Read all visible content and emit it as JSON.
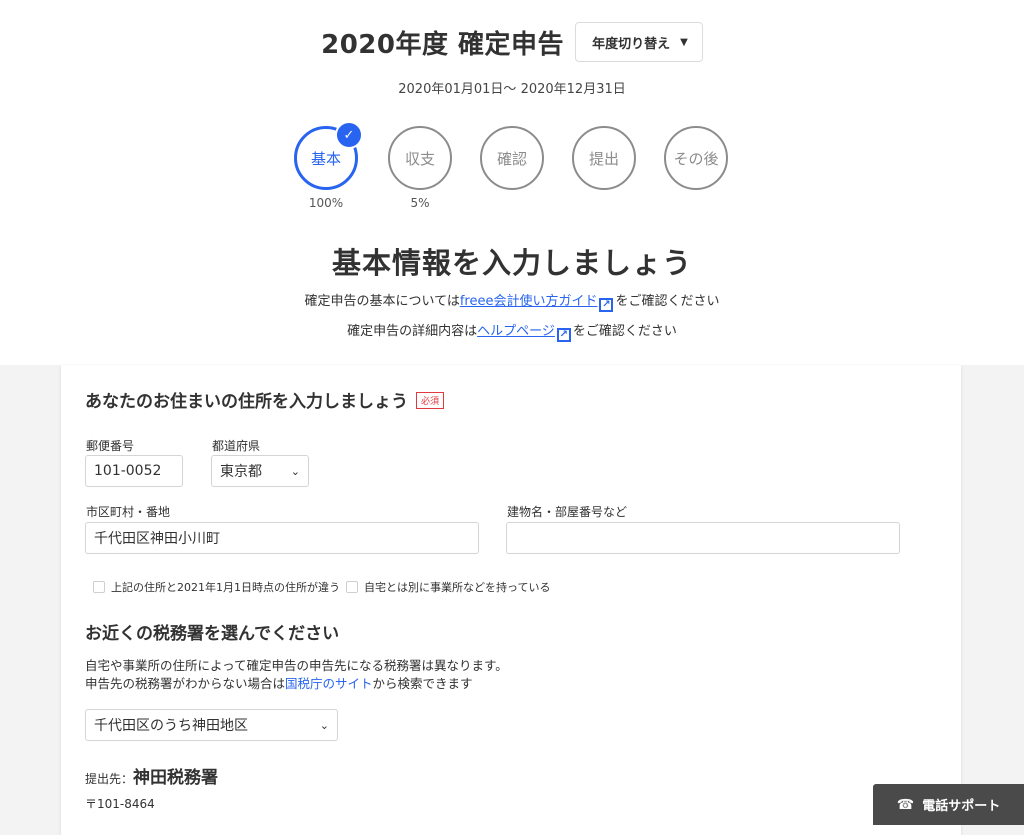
{
  "header": {
    "title": "2020年度 確定申告",
    "year_switch_label": "年度切り替え",
    "period": "2020年01月01日〜 2020年12月31日"
  },
  "steps": [
    {
      "label": "基本",
      "progress": "100%",
      "active": true
    },
    {
      "label": "収支",
      "progress": "5%",
      "active": false
    },
    {
      "label": "確認",
      "progress": "",
      "active": false
    },
    {
      "label": "提出",
      "progress": "",
      "active": false
    },
    {
      "label": "その後",
      "progress": "",
      "active": false
    }
  ],
  "intro": {
    "heading": "基本情報を入力しましょう",
    "line1_prefix": "確定申告の基本については",
    "line1_link": "freee会計使い方ガイド",
    "line1_suffix": "をご確認ください",
    "line2_prefix": "確定申告の詳細内容は",
    "line2_link": "ヘルプページ",
    "line2_suffix": "をご確認ください"
  },
  "address": {
    "section_title": "あなたのお住まいの住所を入力しましょう",
    "required_badge": "必須",
    "postal_label": "郵便番号",
    "postal_value": "101-0052",
    "prefecture_label": "都道府県",
    "prefecture_value": "東京都",
    "city_label": "市区町村・番地",
    "city_value": "千代田区神田小川町",
    "building_label": "建物名・部屋番号など",
    "building_value": "",
    "checkbox1": "上記の住所と2021年1月1日時点の住所が違う",
    "checkbox2": "自宅とは別に事業所などを持っている"
  },
  "tax_office": {
    "section_title": "お近くの税務署を選んでください",
    "desc_line1": "自宅や事業所の住所によって確定申告の申告先になる税務署は異なります。",
    "desc_line2_prefix": "申告先の税務署がわからない場合は",
    "desc_line2_link": "国税庁のサイト",
    "desc_line2_suffix": "から検索できます",
    "selected_area": "千代田区のうち神田地区",
    "dest_label": "提出先：",
    "dest_name": "神田税務署",
    "dest_postal": "〒101-8464"
  },
  "support": {
    "label": "電話サポート",
    "icon": "phone-icon"
  },
  "colors": {
    "accent": "#2864f0",
    "required": "#e0393e",
    "support_bg": "#4a4a4a"
  }
}
